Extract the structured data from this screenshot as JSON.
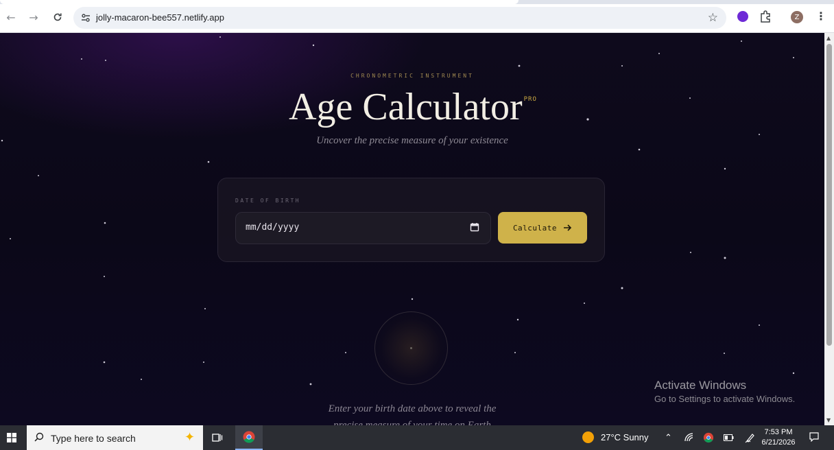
{
  "browser": {
    "url": "jolly-macaron-bee557.netlify.app",
    "profile_initial": "Z"
  },
  "page": {
    "overline": "CHRONOMETRIC INSTRUMENT",
    "title": "Age Calculator",
    "badge": "PRO",
    "subtitle": "Uncover the precise measure of your existence",
    "form": {
      "label": "DATE OF BIRTH",
      "date_placeholder": "mm/dd/yyyy",
      "button_label": "Calculate"
    },
    "hint_line1": "Enter your birth date above to reveal the",
    "hint_line2": "precise measure of your time on Earth"
  },
  "watermark": {
    "line1": "Activate Windows",
    "line2": "Go to Settings to activate Windows."
  },
  "taskbar": {
    "search_placeholder": "Type here to search",
    "weather": "27°C  Sunny",
    "time": "7:53 PM",
    "date": "6/21/2026"
  },
  "colors": {
    "accent_gold": "#cfb24a",
    "background": "#0b0818",
    "title": "#f2eee4"
  }
}
